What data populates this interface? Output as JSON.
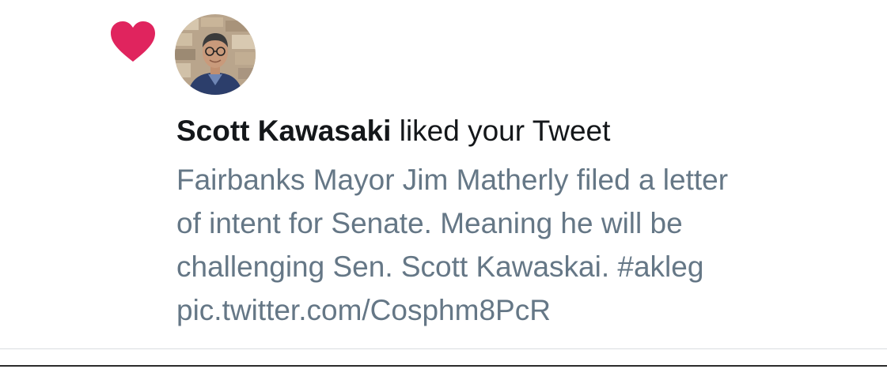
{
  "notification": {
    "type_icon": "heart-icon",
    "heart_color": "#e0245e",
    "avatar_icon": "user-avatar",
    "user_name": "Scott Kawasaki",
    "action_text": " liked your Tweet",
    "tweet_lines": [
      "Fairbanks Mayor Jim Matherly filed a letter",
      "of intent for Senate. Meaning he will be",
      "challenging Sen. Scott Kawaskai. #akleg",
      "pic.twitter.com/Cosphm8PcR"
    ]
  },
  "colors": {
    "name_text": "#14171a",
    "tweet_text": "#657786",
    "divider": "#d9dde0"
  }
}
